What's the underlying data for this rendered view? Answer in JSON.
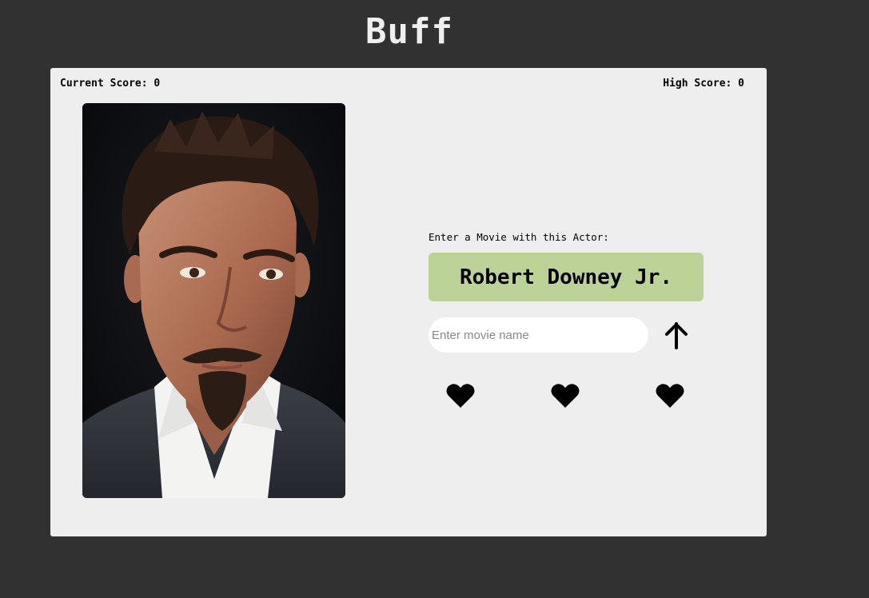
{
  "app": {
    "title": "Buff"
  },
  "scores": {
    "current_label": "Current Score: 0",
    "high_label": "High Score: 0"
  },
  "game": {
    "prompt": "Enter a Movie with this Actor:",
    "actor_name": "Robert Downey Jr.",
    "actor_photo_alt": "Robert Downey Jr.",
    "input_placeholder": "Enter movie name",
    "input_value": "",
    "submit_icon": "arrow-up-icon",
    "lives": {
      "remaining": 3,
      "max": 3,
      "icon": "heart-icon"
    }
  },
  "colors": {
    "background": "#313131",
    "card": "#eeeeee",
    "actor_box": "#bdd296",
    "title": "#efefef"
  }
}
